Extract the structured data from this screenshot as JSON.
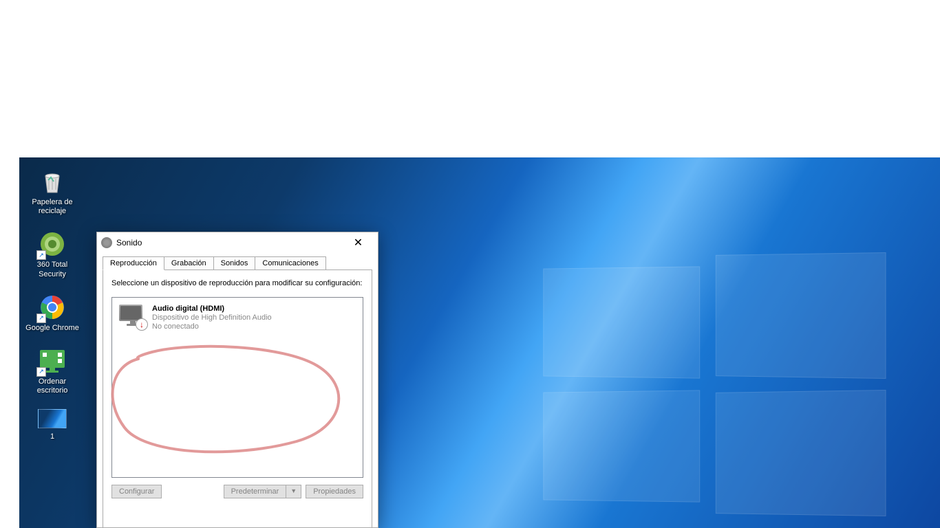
{
  "desktop": {
    "icons": [
      {
        "label": "Papelera de reciclaje"
      },
      {
        "label": "360 Total Security"
      },
      {
        "label": "Google Chrome"
      },
      {
        "label": "Ordenar escritorio"
      },
      {
        "label": "1"
      }
    ]
  },
  "window": {
    "title": "Sonido",
    "tabs": [
      {
        "label": "Reproducción",
        "active": true
      },
      {
        "label": "Grabación"
      },
      {
        "label": "Sonidos"
      },
      {
        "label": "Comunicaciones"
      }
    ],
    "instruction": "Seleccione un dispositivo de reproducción para modificar su configuración:",
    "devices": [
      {
        "name": "Audio digital (HDMI)",
        "desc": "Dispositivo de High Definition Audio",
        "status": "No conectado"
      }
    ],
    "buttons": {
      "configure": "Configurar",
      "default": "Predeterminar",
      "properties": "Propiedades"
    }
  }
}
